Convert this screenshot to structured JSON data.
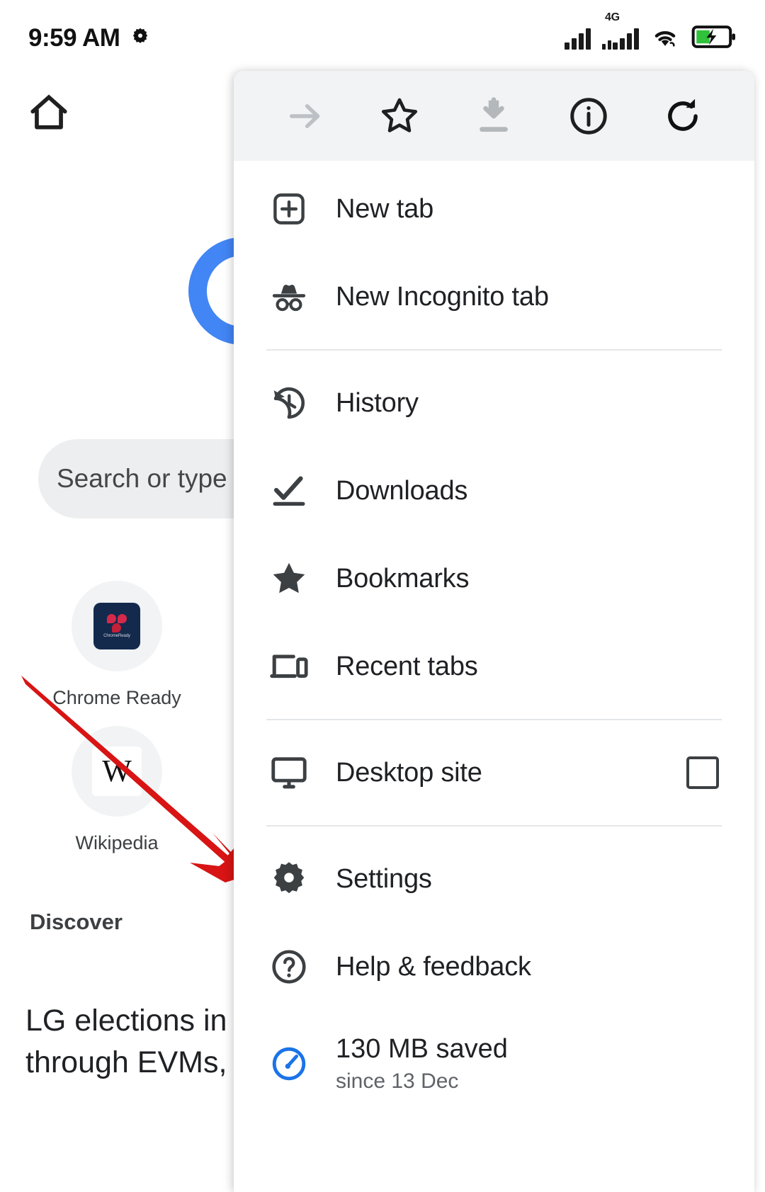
{
  "status_bar": {
    "time": "9:59 AM",
    "settings_icon": "gear-icon",
    "network_label": "4G",
    "wifi_icon": "wifi-icon",
    "battery_icon": "battery-charging-icon",
    "signal_icon": "signal-bars-icon"
  },
  "ntp": {
    "home_icon": "home-icon",
    "logo": "chrome-logo",
    "search": {
      "placeholder": "Search or type w",
      "icon": "search-input"
    },
    "shortcuts": [
      {
        "label": "Chrome Ready",
        "tile_text": "ChromeReady"
      },
      {
        "label": "Wikipedia",
        "tile_text": "W"
      }
    ],
    "discover_heading": "Discover",
    "article_headline": "LG elections in\nthrough EVMs,"
  },
  "annotation": {
    "arrow_color": "#d81414",
    "points_to": "Settings"
  },
  "menu": {
    "toolbar": [
      {
        "name": "forward-arrow-icon",
        "label": "Forward",
        "disabled": true
      },
      {
        "name": "star-icon",
        "label": "Bookmark",
        "disabled": false
      },
      {
        "name": "download-icon",
        "label": "Download page",
        "disabled": true
      },
      {
        "name": "info-icon",
        "label": "Page info",
        "disabled": false
      },
      {
        "name": "reload-icon",
        "label": "Reload",
        "disabled": false
      }
    ],
    "items": [
      {
        "label": "New tab",
        "icon": "new-tab-icon"
      },
      {
        "label": "New Incognito tab",
        "icon": "incognito-icon"
      },
      {
        "label": "History",
        "icon": "history-icon"
      },
      {
        "label": "Downloads",
        "icon": "downloads-icon"
      },
      {
        "label": "Bookmarks",
        "icon": "bookmarks-star-icon"
      },
      {
        "label": "Recent tabs",
        "icon": "recent-tabs-icon"
      },
      {
        "label": "Desktop site",
        "icon": "desktop-site-icon",
        "checkbox": false
      },
      {
        "label": "Settings",
        "icon": "settings-gear-icon"
      },
      {
        "label": "Help & feedback",
        "icon": "help-circle-icon"
      }
    ],
    "data_saver": {
      "primary": "130 MB saved",
      "secondary": "since 13 Dec",
      "icon": "speedometer-icon",
      "accent_color": "#1a73e8"
    }
  }
}
